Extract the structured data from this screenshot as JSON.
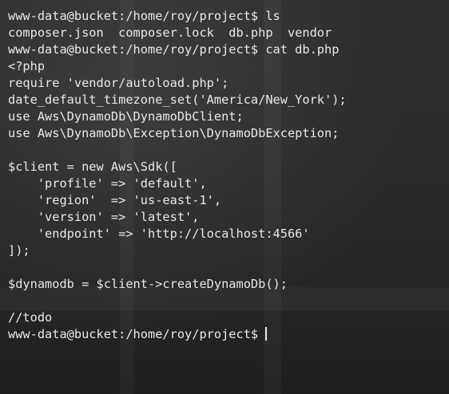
{
  "terminal": {
    "lines": [
      "www-data@bucket:/home/roy/project$ ls",
      "composer.json  composer.lock  db.php  vendor",
      "www-data@bucket:/home/roy/project$ cat db.php",
      "<?php",
      "require 'vendor/autoload.php';",
      "date_default_timezone_set('America/New_York');",
      "use Aws\\DynamoDb\\DynamoDbClient;",
      "use Aws\\DynamoDb\\Exception\\DynamoDbException;",
      "",
      "$client = new Aws\\Sdk([",
      "    'profile' => 'default',",
      "    'region'  => 'us-east-1',",
      "    'version' => 'latest',",
      "    'endpoint' => 'http://localhost:4566'",
      "]);",
      "",
      "$dynamodb = $client->createDynamoDb();",
      "",
      "//todo"
    ],
    "prompt": "www-data@bucket:/home/roy/project$ "
  }
}
